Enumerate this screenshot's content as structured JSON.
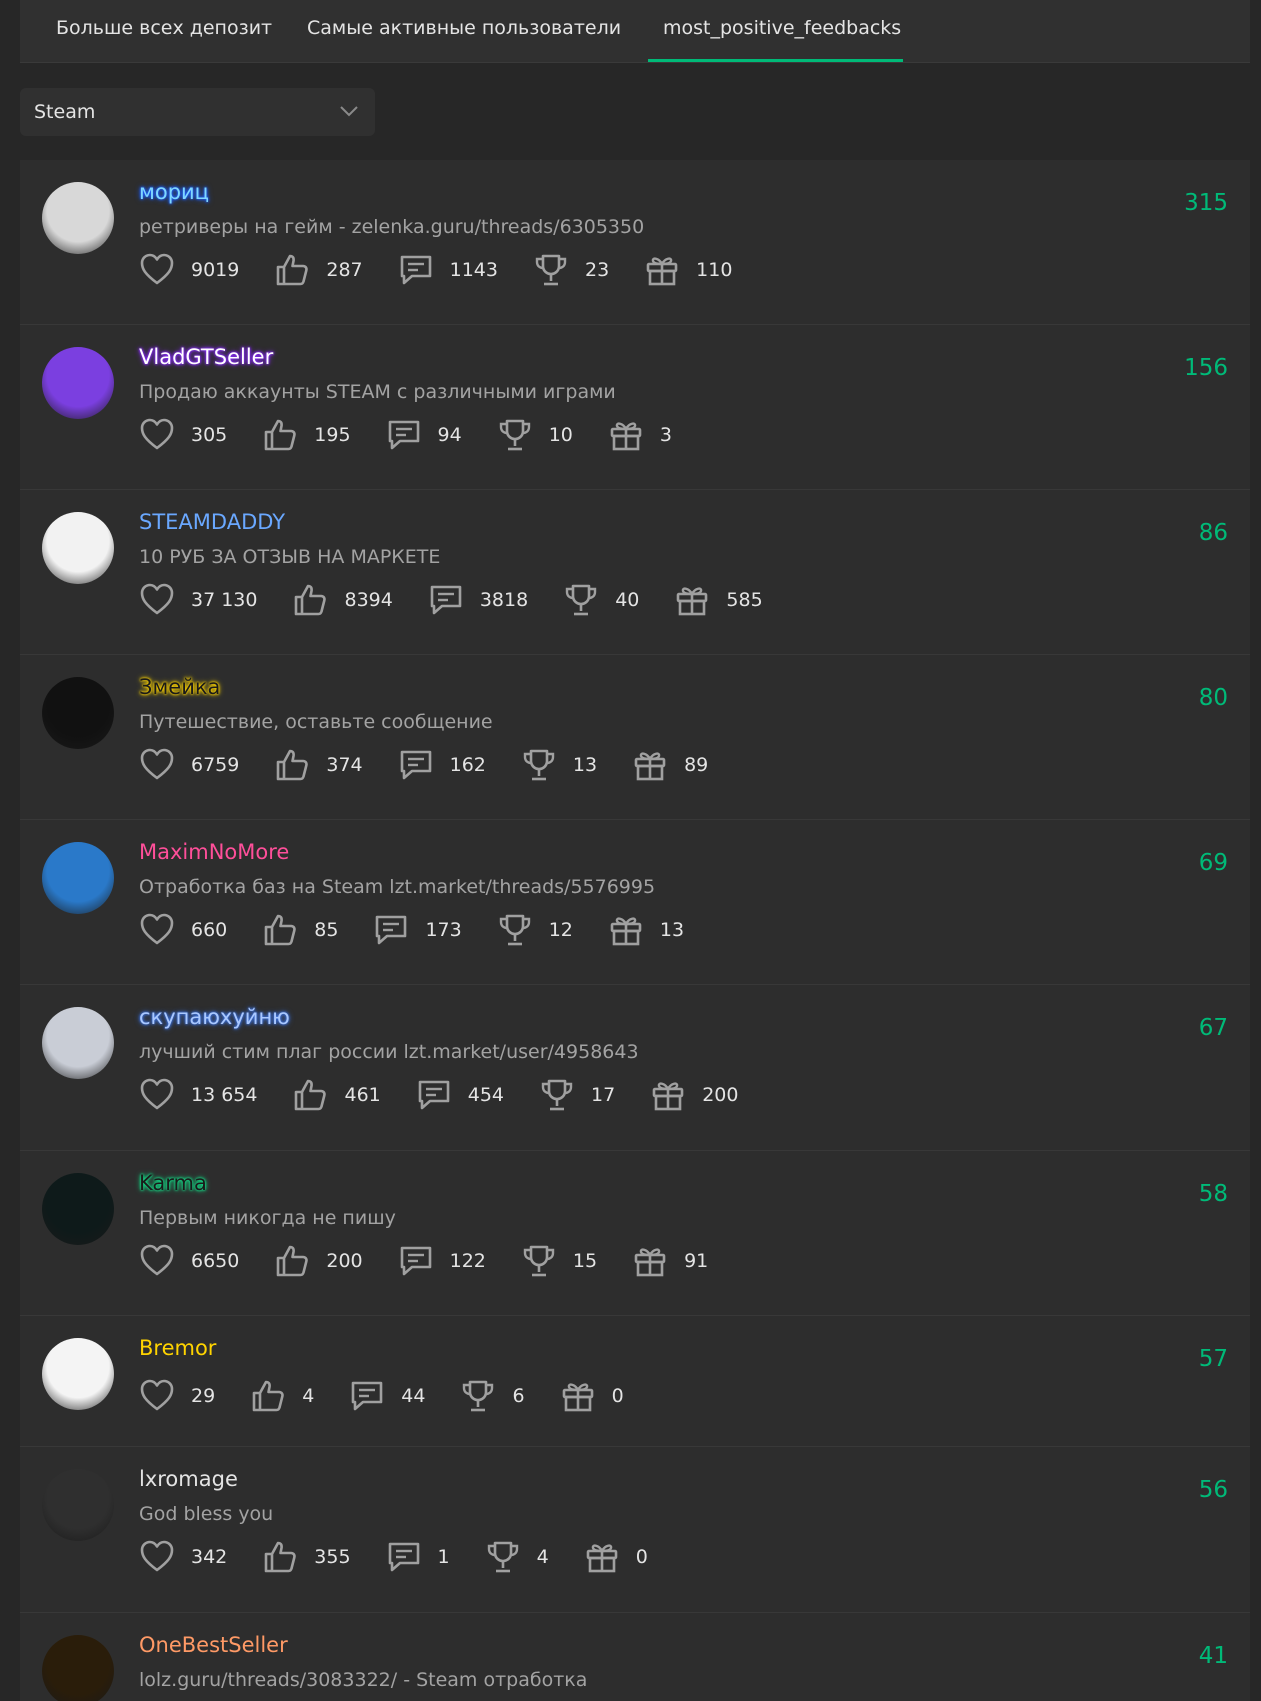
{
  "tabs": [
    {
      "label": "Больше всех депозит",
      "active": false
    },
    {
      "label": "Самые активные пользователи",
      "active": false
    },
    {
      "label": "most_positive_feedbacks",
      "active": true
    }
  ],
  "filter": {
    "value": "Steam"
  },
  "colors": {
    "accent": "#00ba78",
    "background": "#272727",
    "panel": "#2d2d2d"
  },
  "stat_icons": [
    "heart-icon",
    "thumbs-up-icon",
    "message-icon",
    "trophy-icon",
    "gift-icon"
  ],
  "users": [
    {
      "name": "мориц",
      "name_color": "#7fd7ff",
      "glow": "#1e5fff",
      "desc": "ретриверы на гейм - zelenka.guru/threads/6305350",
      "stats": [
        "9019",
        "287",
        "1143",
        "23",
        "110"
      ],
      "count": "315",
      "avatar_color": "#d8d8d8"
    },
    {
      "name": "VladGTSeller",
      "name_color": "#ffffff",
      "glow": "#8a2cff",
      "desc": "Продаю аккаунты STEAM с различными играми",
      "stats": [
        "305",
        "195",
        "94",
        "10",
        "3"
      ],
      "count": "156",
      "avatar_color": "#7b3fe0"
    },
    {
      "name": "STEAMDADDY",
      "name_color": "#6aa8ff",
      "glow": "",
      "desc": "10 РУБ ЗА ОТЗЫВ НА МАРКЕТЕ",
      "stats": [
        "37 130",
        "8394",
        "3818",
        "40",
        "585"
      ],
      "count": "86",
      "avatar_color": "#f2f2f2"
    },
    {
      "name": "Змейка",
      "name_color": "#1a1a1a",
      "glow": "#ffd500",
      "desc": "Путешествие, оставьте сообщение",
      "stats": [
        "6759",
        "374",
        "162",
        "13",
        "89"
      ],
      "count": "80",
      "avatar_color": "#111111"
    },
    {
      "name": "MaximNoMore",
      "name_color": "#ff4f9a",
      "glow": "",
      "desc": "Отработка баз на Steam lzt.market/threads/5576995",
      "stats": [
        "660",
        "85",
        "173",
        "12",
        "13"
      ],
      "count": "69",
      "avatar_color": "#2a79c9"
    },
    {
      "name": "скупаюхуйню",
      "name_color": "#a9c8ff",
      "glow": "#3b6fd8",
      "desc": "лучший стим плаг россии lzt.market/user/4958643",
      "stats": [
        "13 654",
        "461",
        "454",
        "17",
        "200"
      ],
      "count": "67",
      "avatar_color": "#c9cdd6"
    },
    {
      "name": "Karma",
      "name_color": "#1a1a1a",
      "glow": "#13e28a",
      "desc": "Первым никогда не пишу",
      "stats": [
        "6650",
        "200",
        "122",
        "15",
        "91"
      ],
      "count": "58",
      "avatar_color": "#0e1a1a"
    },
    {
      "name": "Bremor",
      "name_color": "#ffd400",
      "glow": "",
      "desc": "",
      "stats": [
        "29",
        "4",
        "44",
        "6",
        "0"
      ],
      "count": "57",
      "avatar_color": "#f4f4f4"
    },
    {
      "name": "lxromage",
      "name_color": "#e4e4e4",
      "glow": "",
      "desc": "God bless you",
      "stats": [
        "342",
        "355",
        "1",
        "4",
        "0"
      ],
      "count": "56",
      "avatar_color": "#2f2f2f"
    },
    {
      "name": "OneBestSeller",
      "name_color": "#ff9a66",
      "glow": "",
      "desc": "lolz.guru/threads/3083322/ - Steam отработка",
      "stats": [
        "",
        "",
        "",
        "",
        ""
      ],
      "count": "41",
      "avatar_color": "#2a1d0a"
    }
  ]
}
